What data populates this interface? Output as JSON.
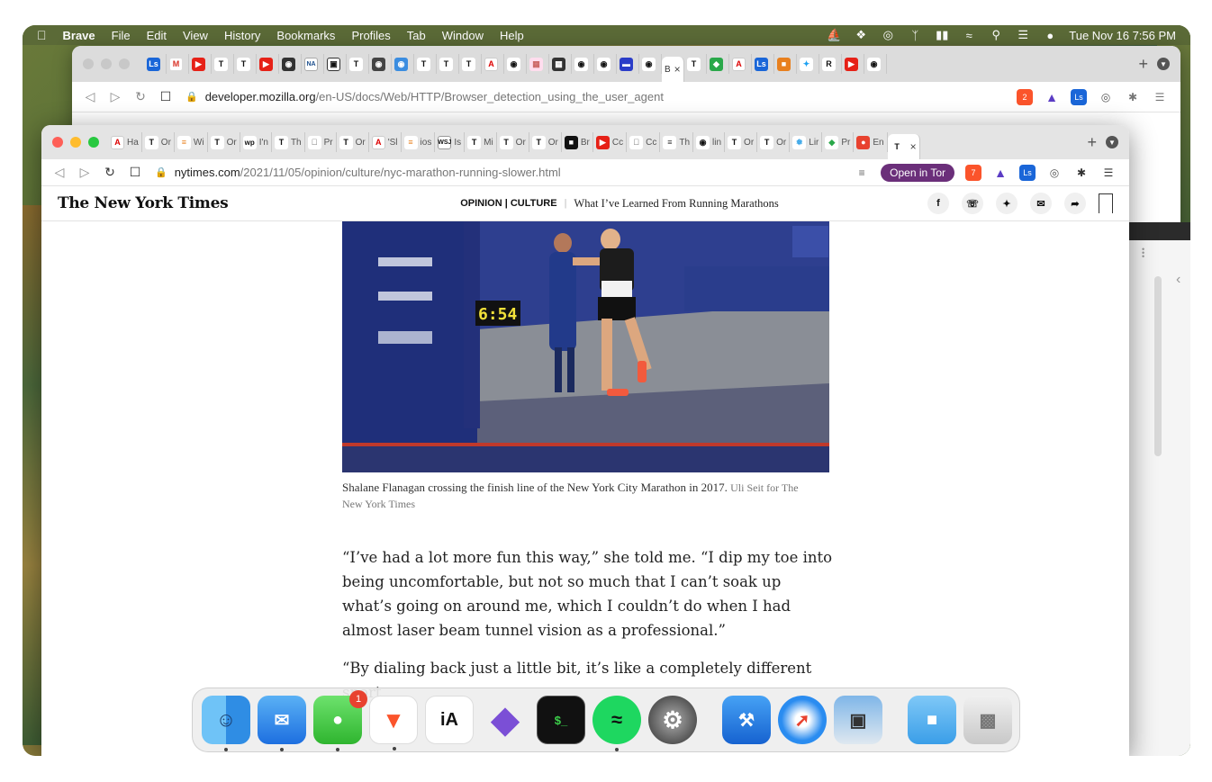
{
  "menubar": {
    "app_name": "Brave",
    "items": [
      "File",
      "Edit",
      "View",
      "History",
      "Bookmarks",
      "Profiles",
      "Tab",
      "Window",
      "Help"
    ],
    "clock": "Tue Nov 16  7:56 PM"
  },
  "back_window": {
    "url_host": "developer.mozilla.org",
    "url_path": "/en-US/docs/Web/HTTP/Browser_detection_using_the_user_agent",
    "active_tab_label": "B",
    "brave_shield_count": "2"
  },
  "front_window": {
    "url_host": "nytimes.com",
    "url_path": "/2021/11/05/opinion/culture/nyc-marathon-running-slower.html",
    "open_in_tor_label": "Open in Tor",
    "brave_shield_count": "7",
    "tabs": [
      "Ha",
      "Or",
      "Wi",
      "Or",
      "I'n",
      "Th",
      "Pr",
      "Or",
      "'Sl",
      "ios",
      "Is",
      "Mi",
      "Or",
      "Or",
      "Br",
      "Cc",
      "Cc",
      "Th",
      "lin",
      "Or",
      "Or",
      "Lir",
      "Pr",
      "En"
    ]
  },
  "nyt": {
    "logo": "The New York Times",
    "section": "OPINION | CULTURE",
    "headline": "What I’ve Learned From Running Marathons",
    "share_icons": [
      "facebook-icon",
      "whatsapp-icon",
      "twitter-icon",
      "email-icon",
      "share-icon"
    ]
  },
  "article": {
    "photo_clock": "6:54",
    "caption": "Shalane Flanagan crossing the finish line of the New York City Marathon in 2017.",
    "credit": "Uli Seit for The New York Times",
    "paragraph1": "“I’ve had a lot more fun this way,” she told me. “I dip my toe into being uncomfortable, but not so much that I can’t soak up what’s going on around me, which I couldn’t do when I had almost laser beam tunnel vision as a professional.”",
    "paragraph2": "“By dialing back just a little bit, it’s like a completely different sport"
  },
  "dock": {
    "apps": [
      "Finder",
      "Mail",
      "Messages",
      "Brave",
      "iA Writer",
      "Obsidian",
      "Terminal",
      "Spotify",
      "System Preferences",
      "Xcode",
      "Safari",
      "Preview",
      "Downloads",
      "Trash"
    ],
    "messages_badge": "1",
    "ia_label": "iA",
    "terminal_label": "$_"
  }
}
